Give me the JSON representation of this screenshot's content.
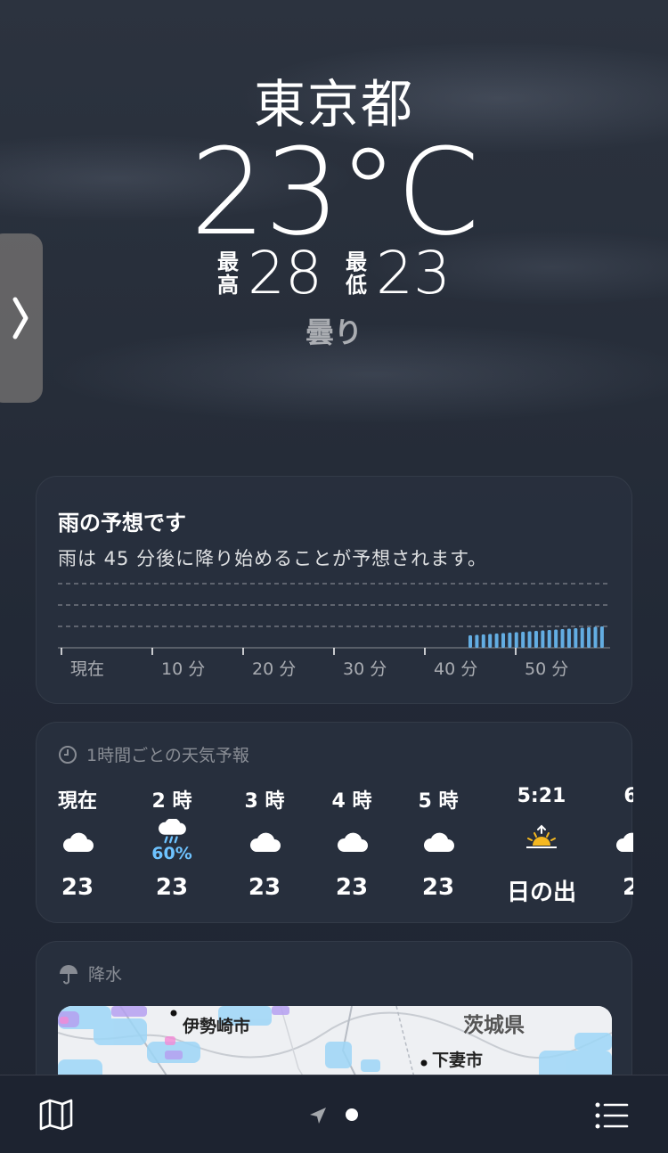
{
  "location": {
    "city": "東京都",
    "temp": "23°C",
    "high_label": [
      "最",
      "高"
    ],
    "high": "28",
    "low_label": [
      "最",
      "低"
    ],
    "low": "23",
    "condition": "曇り"
  },
  "rain": {
    "title": "雨の予想です",
    "description": "雨は 45 分後に降り始めることが予想されます。",
    "ticks": [
      "現在",
      "10 分",
      "20 分",
      "30 分",
      "40 分",
      "50 分"
    ]
  },
  "hourly": {
    "header": "1時間ごとの天気予報",
    "items": [
      {
        "time": "現在",
        "icon": "cloud-icon",
        "pop": "",
        "temp": "23"
      },
      {
        "time": "2 時",
        "icon": "rain-cloud-icon",
        "pop": "60%",
        "temp": "23"
      },
      {
        "time": "3 時",
        "icon": "cloud-icon",
        "pop": "",
        "temp": "23"
      },
      {
        "time": "4 時",
        "icon": "cloud-icon",
        "pop": "",
        "temp": "23"
      },
      {
        "time": "5 時",
        "icon": "cloud-icon",
        "pop": "",
        "temp": "23"
      },
      {
        "time": "5:21",
        "icon": "sunrise-icon",
        "pop": "",
        "temp": "日の出"
      },
      {
        "time": "6",
        "icon": "cloud-icon",
        "pop": "",
        "temp": "2"
      }
    ]
  },
  "precip": {
    "header": "降水",
    "labels": {
      "isesaki": "伊勢崎市",
      "ibaraki": "茨城県",
      "shimotsuma": "下妻市"
    }
  },
  "colors": {
    "accent_rain": "#6ec3ff",
    "sun": "#f5b820"
  }
}
